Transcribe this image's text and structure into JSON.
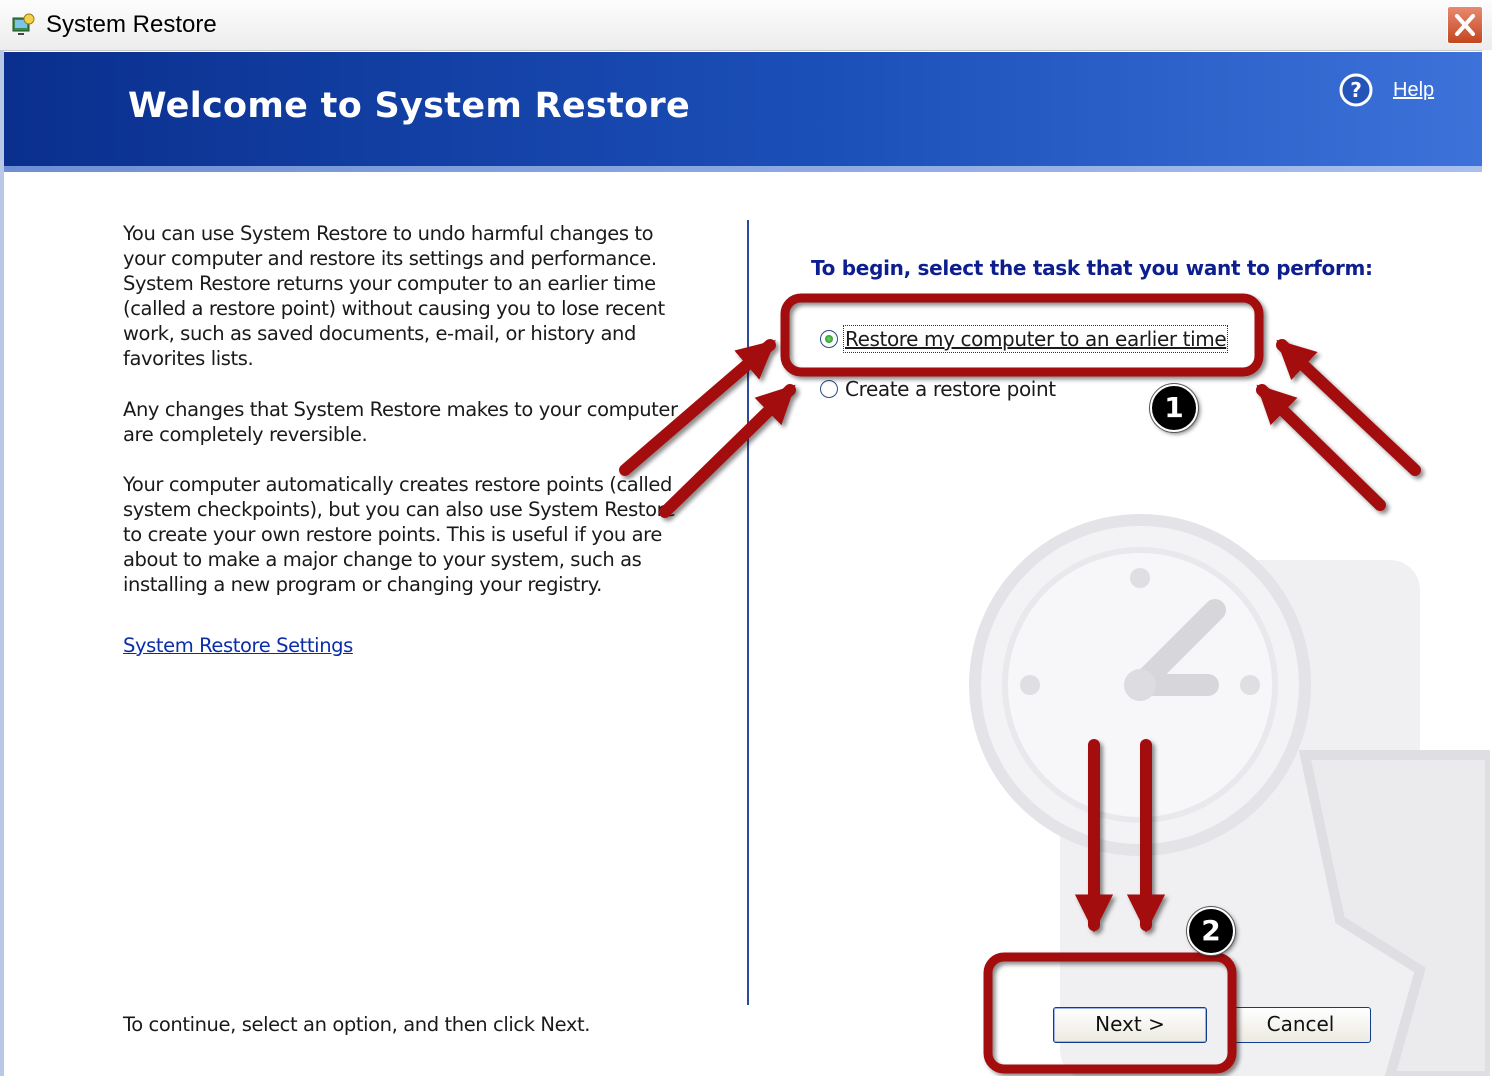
{
  "window": {
    "title": "System Restore",
    "close_icon": "close-icon",
    "app_icon": "system-restore-icon"
  },
  "banner": {
    "title": "Welcome to System Restore",
    "help_icon": "help-icon",
    "help_label": "Help"
  },
  "left_pane": {
    "paragraphs": [
      "You can use System Restore to undo harmful changes to your computer and restore its settings and performance. System Restore returns your computer to an earlier time (called a restore point) without causing you to lose recent work, such as saved documents, e-mail, or history and favorites lists.",
      "Any changes that System Restore makes to your computer are completely reversible.",
      "Your computer automatically creates restore points (called system checkpoints), but you can also use System Restore to create your own restore points. This is useful if you are about to make a major change to your system, such as installing a new program or changing your registry."
    ],
    "settings_link": "System Restore Settings",
    "continue_text": "To continue, select an option, and then click Next."
  },
  "right_pane": {
    "prompt": "To begin, select the task that you want to perform:",
    "options": [
      {
        "label": "Restore my computer to an earlier time",
        "checked": true
      },
      {
        "label": "Create a restore point",
        "checked": false
      }
    ]
  },
  "buttons": {
    "next": "Next >",
    "cancel": "Cancel"
  },
  "annotations": {
    "badge_1": "1",
    "badge_2": "2",
    "highlight_color": "#a31010"
  }
}
